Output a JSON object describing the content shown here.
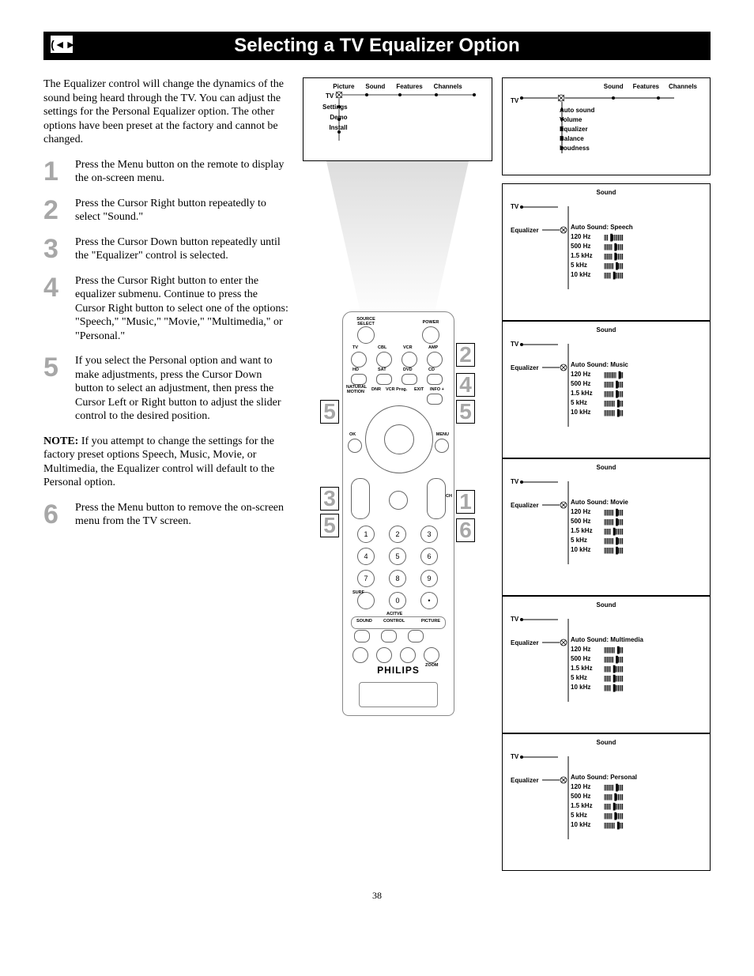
{
  "title": "Selecting a TV Equalizer Option",
  "speaker_icon": "((◄►",
  "intro": "The Equalizer control will change the dynamics of the sound being heard through the TV. You can adjust the settings for the Personal Equalizer option. The other options have been preset at the factory and cannot be changed.",
  "steps": [
    {
      "n": "1",
      "text": "Press the Menu button on the remote to display the on-screen menu."
    },
    {
      "n": "2",
      "text": "Press the Cursor Right button repeatedly to select \"Sound.\""
    },
    {
      "n": "3",
      "text": "Press the Cursor Down button repeatedly until the \"Equalizer\" control is selected."
    },
    {
      "n": "4",
      "text": "Press the Cursor Right button to enter the equalizer submenu. Continue to press the Cursor Right button to select one of the options: \"Speech,\" \"Music,\" \"Movie,\" \"Multimedia,\" or \"Personal.\""
    },
    {
      "n": "5",
      "text": "If you select the Personal option and want to make adjustments, press the Cursor Down button to select an adjustment, then press the Cursor Left or Right button to adjust the slider control to the desired position."
    }
  ],
  "note_label": "NOTE:",
  "note_text": " If you attempt to change the settings for the factory preset options Speech, Music, Movie, or Multimedia, the Equalizer control will default to the Personal option.",
  "step6": {
    "n": "6",
    "text": "Press the Menu button to remove the on-screen menu from the TV screen."
  },
  "menu1": {
    "tv": "TV",
    "top": [
      "Picture",
      "Sound",
      "Features",
      "Channels"
    ],
    "left": [
      "Settings",
      "Demo",
      "Install"
    ]
  },
  "remote": {
    "labels": {
      "source_select": "SOURCE SELECT",
      "power": "POWER",
      "tv": "TV",
      "cbl": "CBL",
      "vcr": "VCR",
      "amp": "AMP",
      "hd": "HD",
      "sat": "SAT",
      "dvd": "DVD",
      "cd": "CD",
      "natural_motion": "NATURAL MOTION",
      "dnr": "DNR",
      "vcr_prog": "VCR Prog.",
      "exit": "EXIT",
      "info": "INFO +",
      "ok": "OK",
      "menu": "MENU",
      "ch": "CH",
      "surf": "SURF",
      "active": "ACITVE",
      "sound": "SOUND",
      "control": "CONTROL",
      "picture": "PICTURE",
      "zoom": "ZOOM"
    },
    "brand": "PHILIPS",
    "callouts": [
      "2",
      "4",
      "5",
      "1",
      "6",
      "3",
      "5",
      "5"
    ]
  },
  "screens": {
    "s1": {
      "title_row": [
        "Sound",
        "Features",
        "Channels"
      ],
      "tv": "TV",
      "items": [
        "Auto sound",
        "Volume",
        "Equalizer",
        "Balance",
        "Loudness"
      ]
    },
    "common": {
      "title": "Sound",
      "tv": "TV",
      "eq": "Equalizer",
      "freqs": [
        "120 Hz",
        "500 Hz",
        "1.5 kHz",
        "5 kHz",
        "10 kHz"
      ]
    },
    "presets": [
      {
        "name": "Auto Sound: Speech",
        "pos": [
          3,
          6,
          6,
          7,
          5
        ]
      },
      {
        "name": "Auto Sound: Music",
        "pos": [
          9,
          7,
          7,
          8,
          8
        ]
      },
      {
        "name": "Auto Sound: Movie",
        "pos": [
          7,
          7,
          5,
          7,
          7
        ]
      },
      {
        "name": "Auto Sound: Multimedia",
        "pos": [
          8,
          7,
          5,
          5,
          5
        ]
      },
      {
        "name": "Auto Sound: Personal",
        "pos": [
          7,
          6,
          5,
          6,
          8
        ]
      }
    ]
  },
  "page": "38"
}
